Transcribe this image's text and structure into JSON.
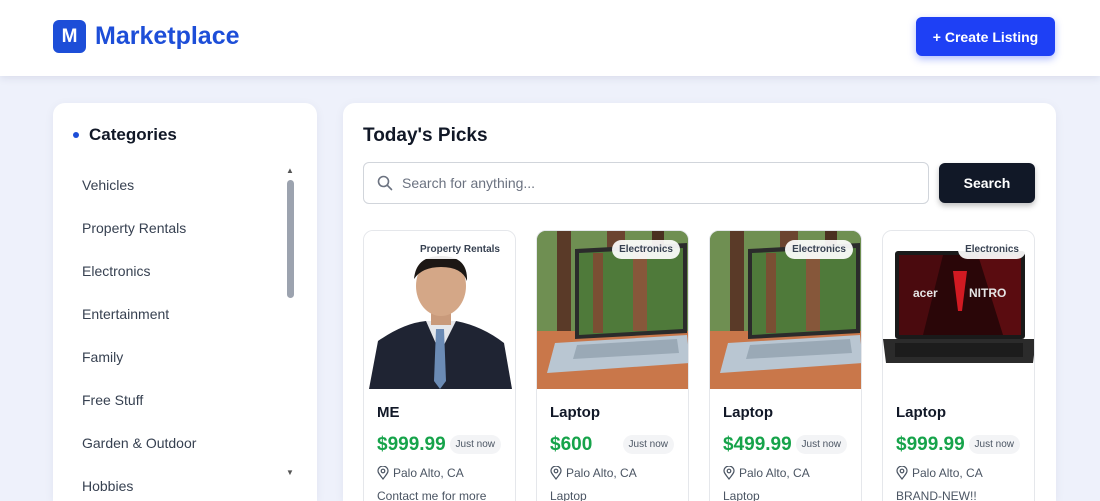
{
  "header": {
    "logo_letter": "M",
    "app_title": "Marketplace",
    "create_label": "+ Create Listing"
  },
  "sidebar": {
    "title": "Categories",
    "items": [
      {
        "label": "Vehicles"
      },
      {
        "label": "Property Rentals"
      },
      {
        "label": "Electronics"
      },
      {
        "label": "Entertainment"
      },
      {
        "label": "Family"
      },
      {
        "label": "Free Stuff"
      },
      {
        "label": "Garden & Outdoor"
      },
      {
        "label": "Hobbies"
      }
    ]
  },
  "main": {
    "title": "Today's Picks",
    "search": {
      "placeholder": "Search for anything...",
      "value": "",
      "button_label": "Search"
    },
    "listings": [
      {
        "category": "Property Rentals",
        "name": "ME",
        "price": "$999.99",
        "time": "Just now",
        "location": "Palo Alto, CA",
        "description": "Contact me for more",
        "image": "portrait-photo"
      },
      {
        "category": "Electronics",
        "name": "Laptop",
        "price": "$600",
        "time": "Just now",
        "location": "Palo Alto, CA",
        "description": "Laptop",
        "image": "laptop-photo"
      },
      {
        "category": "Electronics",
        "name": "Laptop",
        "price": "$499.99",
        "time": "Just now",
        "location": "Palo Alto, CA",
        "description": "Laptop",
        "image": "laptop-photo"
      },
      {
        "category": "Electronics",
        "name": "Laptop",
        "price": "$999.99",
        "time": "Just now",
        "location": "Palo Alto, CA",
        "description": "BRAND-NEW!!",
        "image": "gaming-laptop-photo"
      }
    ]
  },
  "colors": {
    "brand": "#1d4ed8",
    "create_button": "#1e40f5",
    "price": "#16a34a",
    "search_button": "#111827",
    "background": "#eef1fb"
  }
}
